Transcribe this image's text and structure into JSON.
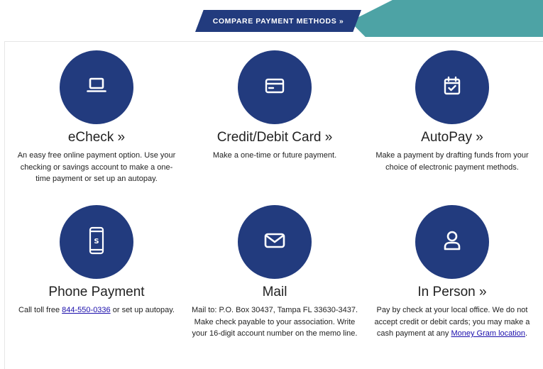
{
  "header": {
    "compare_button": "COMPARE PAYMENT METHODS »"
  },
  "methods": {
    "echeck": {
      "title": "eCheck »",
      "icon": "laptop-icon",
      "desc": "An easy free online payment option. Use your checking or savings account to make a one-time payment or set up an autopay."
    },
    "card": {
      "title": "Credit/Debit Card »",
      "icon": "credit-card-icon",
      "desc": "Make a one-time or future payment."
    },
    "autopay": {
      "title": "AutoPay »",
      "icon": "calendar-check-icon",
      "desc": "Make a payment by drafting funds from your choice of electronic payment methods."
    },
    "phone": {
      "title": "Phone Payment",
      "icon": "smartphone-icon",
      "desc_before": "Call toll free ",
      "phone_link": "844-550-0336",
      "desc_after": " or set up autopay."
    },
    "mail": {
      "title": "Mail",
      "icon": "envelope-icon",
      "desc": "Mail to: P.O. Box 30437, Tampa FL 33630-3437. Make check payable to your association. Write your 16-digit account number on the memo line."
    },
    "in_person": {
      "title": "In Person »",
      "icon": "person-icon",
      "desc_before": "Pay by check at your local office. We do not accept credit or debit cards; you may make a cash payment at any ",
      "link": "Money Gram location",
      "desc_after": "."
    }
  },
  "colors": {
    "navy": "#223b7e",
    "teal": "#4da3a5",
    "link": "#1a0dab"
  }
}
